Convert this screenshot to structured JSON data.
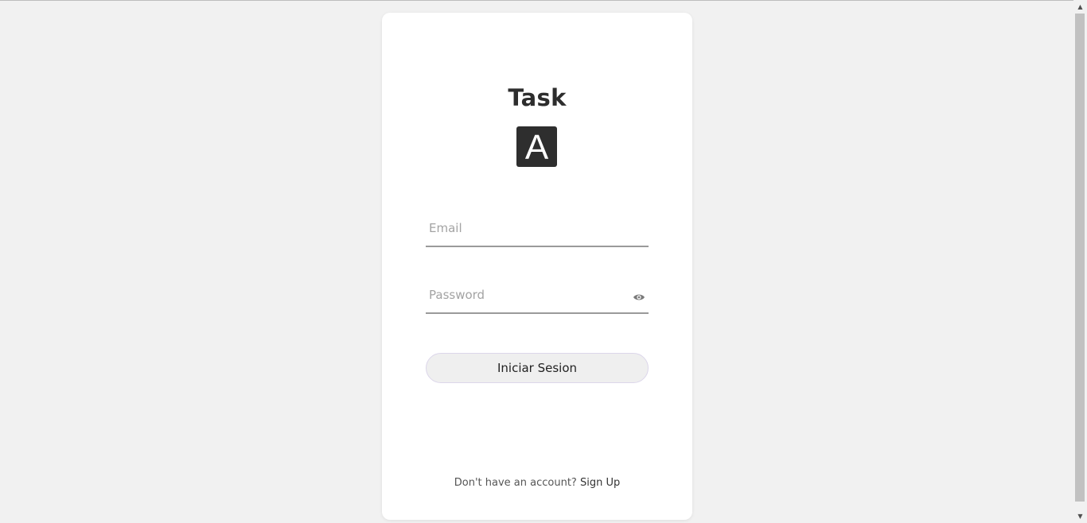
{
  "app": {
    "title": "Task",
    "logo_letter": "A"
  },
  "form": {
    "email_placeholder": "Email",
    "email_value": "",
    "password_placeholder": "Password",
    "password_value": "",
    "submit_label": "Iniciar Sesion"
  },
  "footer": {
    "prompt": "Don't have an account?",
    "signup_label": "Sign Up"
  },
  "icons": {
    "password_toggle": "eye-icon",
    "scroll_up": "triangle-up",
    "scroll_down": "triangle-down"
  },
  "colors": {
    "background": "#f1f1f1",
    "card": "#ffffff",
    "logo_bg": "#2e2e2e",
    "button_bg": "#efefef"
  }
}
